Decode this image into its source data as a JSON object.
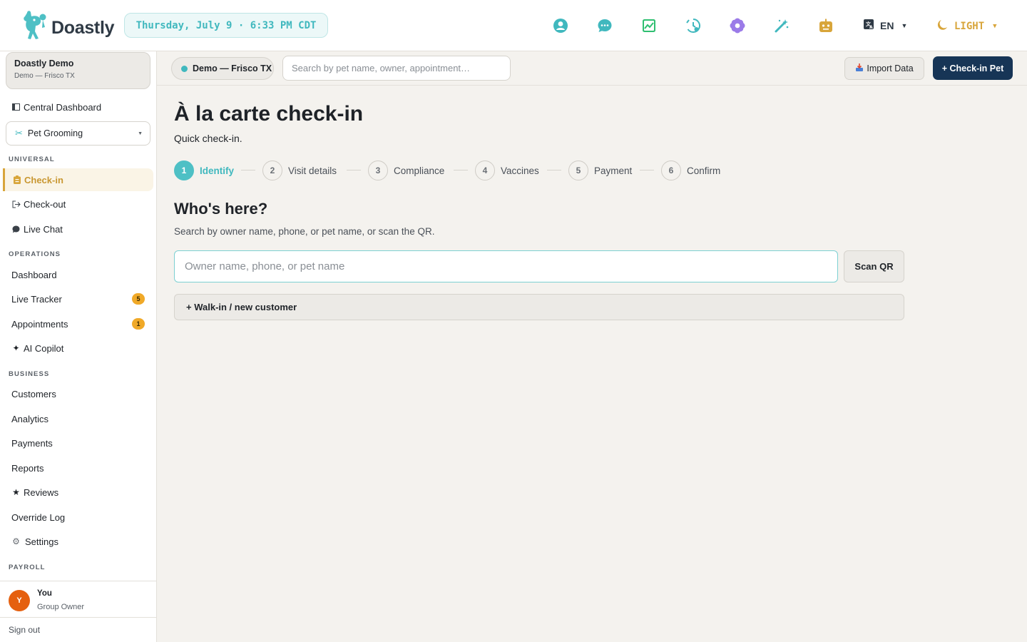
{
  "app": {
    "name": "Doastly"
  },
  "clock": "Thursday, July 9 · 6:33 PM CDT",
  "header": {
    "icons": [
      {
        "name": "user-circle-icon",
        "color": "#40b8be"
      },
      {
        "name": "chat-icon",
        "color": "#40b8be"
      },
      {
        "name": "chart-image-icon",
        "color": "#2fbf71"
      },
      {
        "name": "clock-history-icon",
        "color": "#40b8be"
      },
      {
        "name": "flower-icon",
        "color": "#9b7be8"
      },
      {
        "name": "magic-wand-icon",
        "color": "#40b8be"
      },
      {
        "name": "robot-icon",
        "color": "#d8a53a"
      }
    ],
    "language": "EN",
    "theme": "LIGHT"
  },
  "sidebar": {
    "org_name": "Doastly Demo",
    "org_sub": "Demo — Frisco TX",
    "central_dashboard": "Central Dashboard",
    "service": "Pet Grooming",
    "sections": {
      "universal": "UNIVERSAL",
      "operations": "OPERATIONS",
      "business": "BUSINESS",
      "payroll": "PAYROLL"
    },
    "universal_items": [
      "Check-in",
      "Check-out",
      "Live Chat"
    ],
    "operations_items": [
      {
        "label": "Dashboard",
        "badge": ""
      },
      {
        "label": "Live Tracker",
        "badge": "5"
      },
      {
        "label": "Appointments",
        "badge": "1"
      },
      {
        "label": "AI Copilot",
        "badge": ""
      }
    ],
    "business_items": [
      "Customers",
      "Analytics",
      "Payments",
      "Reports",
      "Reviews",
      "Override Log",
      "Settings"
    ],
    "user": {
      "initial": "Y",
      "name": "You",
      "role": "Group Owner"
    },
    "sign_out": "Sign out"
  },
  "subbar": {
    "location": "Demo — Frisco TX",
    "search_placeholder": "Search by pet name, owner, appointment…",
    "import_label": "Import Data",
    "checkin_label": "+ Check-in Pet"
  },
  "main": {
    "title": "À la carte check-in",
    "subtitle": "Quick check-in.",
    "steps": [
      {
        "num": "1",
        "label": "Identify"
      },
      {
        "num": "2",
        "label": "Visit details"
      },
      {
        "num": "3",
        "label": "Compliance"
      },
      {
        "num": "4",
        "label": "Vaccines"
      },
      {
        "num": "5",
        "label": "Payment"
      },
      {
        "num": "6",
        "label": "Confirm"
      }
    ],
    "active_step": 1,
    "question": "Who's here?",
    "question_sub": "Search by owner name, phone, or pet name, or scan the QR.",
    "owner_placeholder": "Owner name, phone, or pet name",
    "scan_label": "Scan QR",
    "walkin_label": "+ Walk-in / new customer"
  },
  "colors": {
    "accent_teal": "#40b8be",
    "active_gold": "#d8a53a",
    "primary_navy": "#173556",
    "badge_orange": "#f0a928",
    "avatar_orange": "#e5600f"
  }
}
